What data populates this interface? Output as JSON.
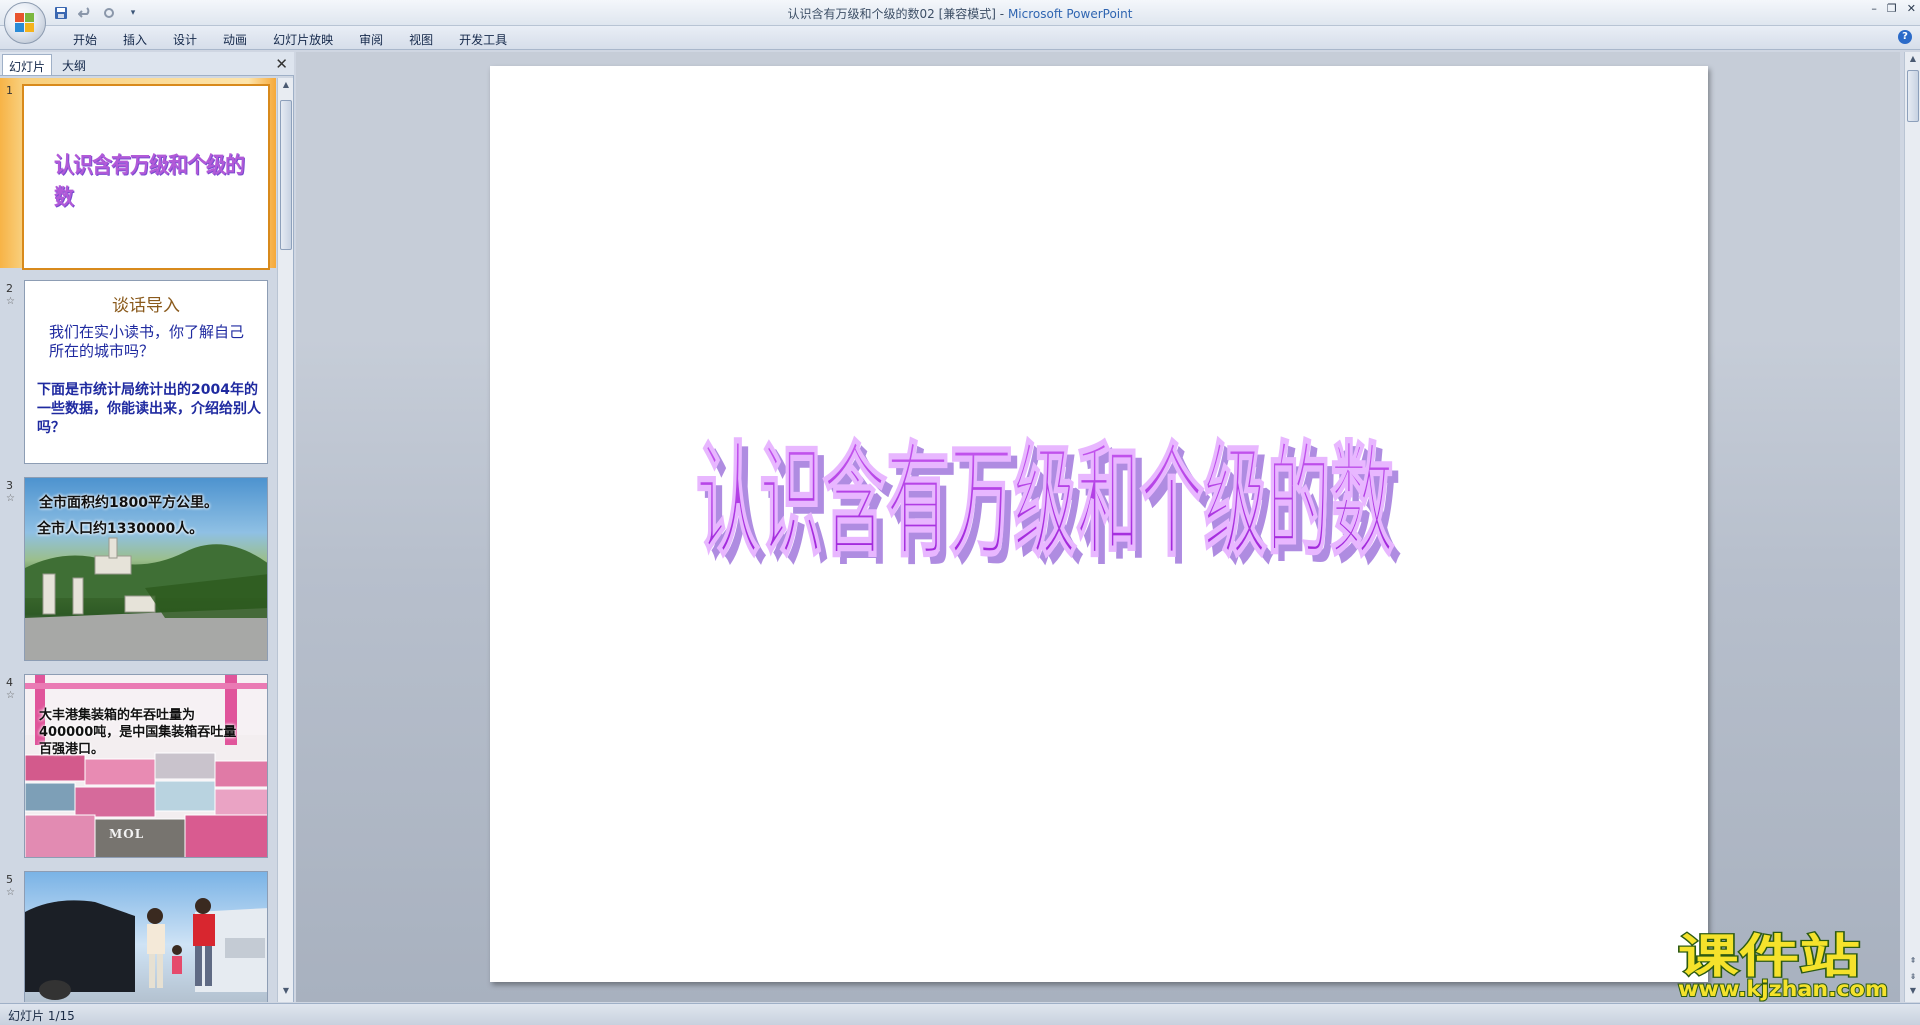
{
  "window": {
    "title": "认识含有万级和个级的数02 [兼容模式]",
    "separator": " - ",
    "app_name": "Microsoft PowerPoint"
  },
  "ribbon": {
    "tabs": [
      "开始",
      "插入",
      "设计",
      "动画",
      "幻灯片放映",
      "审阅",
      "视图",
      "开发工具"
    ]
  },
  "left_pane": {
    "tabs": [
      "幻灯片",
      "大纲"
    ],
    "active_tab": "幻灯片"
  },
  "thumbnails": [
    {
      "num": "1",
      "title": "认识含有万级和个级的数",
      "selected": true
    },
    {
      "num": "2",
      "heading": "谈话导入",
      "line1": "我们在实小读书，你了解自己所在的城市吗？",
      "line2": "下面是市统计局统计出的2004年的一些数据，你能读出来，介绍给别人吗？"
    },
    {
      "num": "3",
      "line1": "全市面积约1800平方公里。",
      "line2": "全市人口约1330000人。"
    },
    {
      "num": "4",
      "line1": "大丰港集装箱的年吞吐量为400000吨，是中国集装箱吞吐量百强港口。",
      "container_mark": "MOL"
    },
    {
      "num": "5"
    }
  ],
  "slide": {
    "title": "认识含有万级和个级的数"
  },
  "status": {
    "slide_indicator": "幻灯片 1/15"
  },
  "watermark": {
    "brand": "课件站",
    "url": "www.kjzhan.com"
  },
  "colors": {
    "title_purple": "#b233e6",
    "title_shadow": "#6e30c9",
    "selected_thumb": "#f7b346",
    "thumb2_heading": "#8a5a1c",
    "thumb2_text": "#1f2aa0"
  }
}
